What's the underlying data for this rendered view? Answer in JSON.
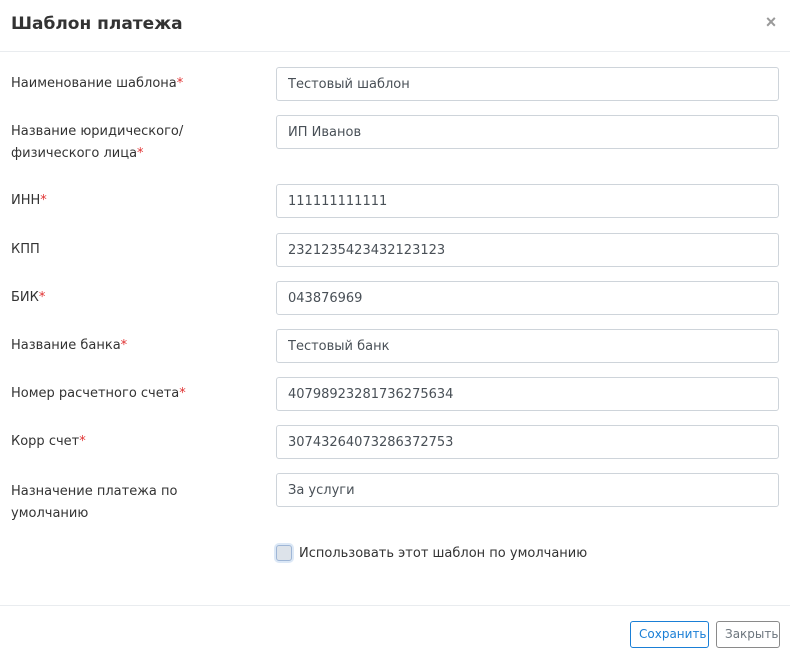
{
  "dialog": {
    "title": "Шаблон платежа",
    "close_glyph": "×"
  },
  "fields": {
    "template_name": {
      "label": "Наименование шаблона",
      "required": "*",
      "value": "Тестовый шаблон"
    },
    "entity_name": {
      "label_line1": "Название юридического/",
      "label_line2": "физического лица",
      "required": "*",
      "value": "ИП Иванов"
    },
    "inn": {
      "label": "ИНН",
      "required": "*",
      "value": "111111111111"
    },
    "kpp": {
      "label": "КПП",
      "value": "2321235423432123123"
    },
    "bik": {
      "label": "БИК",
      "required": "*",
      "value": "043876969"
    },
    "bank_name": {
      "label": "Название банка",
      "required": "*",
      "value": "Тестовый банк"
    },
    "account_number": {
      "label": "Номер расчетного счета",
      "required": "*",
      "value": "40798923281736275634"
    },
    "corr_account": {
      "label": "Корр счет",
      "required": "*",
      "value": "30743264073286372753"
    },
    "payment_purpose": {
      "label_line1": "Назначение платежа по",
      "label_line2": "умолчанию",
      "value": "За услуги"
    }
  },
  "default_checkbox": {
    "label": "Использовать этот шаблон по умолчанию",
    "checked": false
  },
  "footer": {
    "save_label": "Сохранить",
    "close_label": "Закрыть"
  },
  "colors": {
    "primary": "#1a7fd6",
    "required": "#e03030",
    "border": "#ced4da"
  }
}
